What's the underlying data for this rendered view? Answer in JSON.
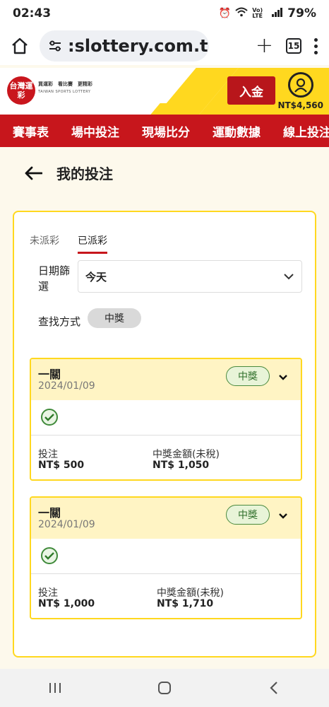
{
  "status_bar": {
    "time": "02:43",
    "signal_label": "Vo) LTE",
    "battery": "79%"
  },
  "browser": {
    "url": ":slottery.com.tw",
    "tab_count": "15"
  },
  "site": {
    "logo_text": "台灣運彩",
    "logo_line1": "買運彩　看比賽　更精彩",
    "logo_line2": "TAIWAN SPORTS LOTTERY",
    "deposit_label": "入金",
    "balance": "NT$4,560"
  },
  "nav": {
    "items": [
      "賽事表",
      "場中投注",
      "現場比分",
      "運動數據",
      "線上投注"
    ]
  },
  "page": {
    "title": "我的投注"
  },
  "tabs": {
    "unsettled": "未派彩",
    "settled": "已派彩"
  },
  "filter": {
    "date_label": "日期篩選",
    "date_value": "今天",
    "search_label": "查找方式",
    "search_chip": "中獎"
  },
  "bets": [
    {
      "type": "一關",
      "date": "2024/01/09",
      "status": "中獎",
      "stake_label": "投注",
      "stake": "NT$ 500",
      "payout_label": "中獎金額(未稅)",
      "payout": "NT$ 1,050"
    },
    {
      "type": "一關",
      "date": "2024/01/09",
      "status": "中獎",
      "stake_label": "投注",
      "stake": "NT$ 1,000",
      "payout_label": "中獎金額(未稅)",
      "payout": "NT$ 1,710"
    }
  ]
}
